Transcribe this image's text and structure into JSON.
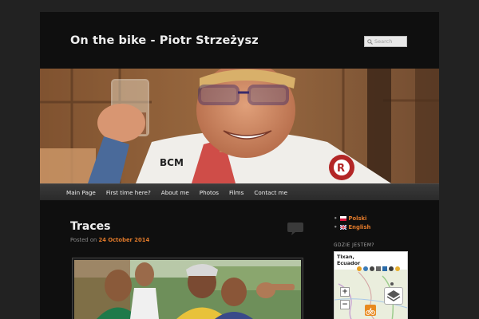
{
  "site": {
    "title": "On the bike - Piotr Strzeżysz"
  },
  "search": {
    "placeholder": "Search"
  },
  "nav": {
    "items": [
      {
        "label": "Main Page"
      },
      {
        "label": "First time here?"
      },
      {
        "label": "About me"
      },
      {
        "label": "Photos"
      },
      {
        "label": "Films"
      },
      {
        "label": "Contact me"
      }
    ]
  },
  "post": {
    "title": "Traces",
    "posted_prefix": "Posted on",
    "date": "24 October 2014"
  },
  "sidebar": {
    "languages": [
      {
        "label": "Polski",
        "flag": "flag-pl-icon"
      },
      {
        "label": "English",
        "flag": "flag-gb-icon"
      }
    ],
    "widget_title": "GDZIE JESTEM?",
    "map": {
      "location_line1": "Tixan,",
      "location_line2": "Ecuador",
      "zoom_in": "+",
      "zoom_out": "−"
    }
  },
  "colors": {
    "accent": "#e27a2a",
    "background": "#222222",
    "page": "#0f0f0f"
  }
}
